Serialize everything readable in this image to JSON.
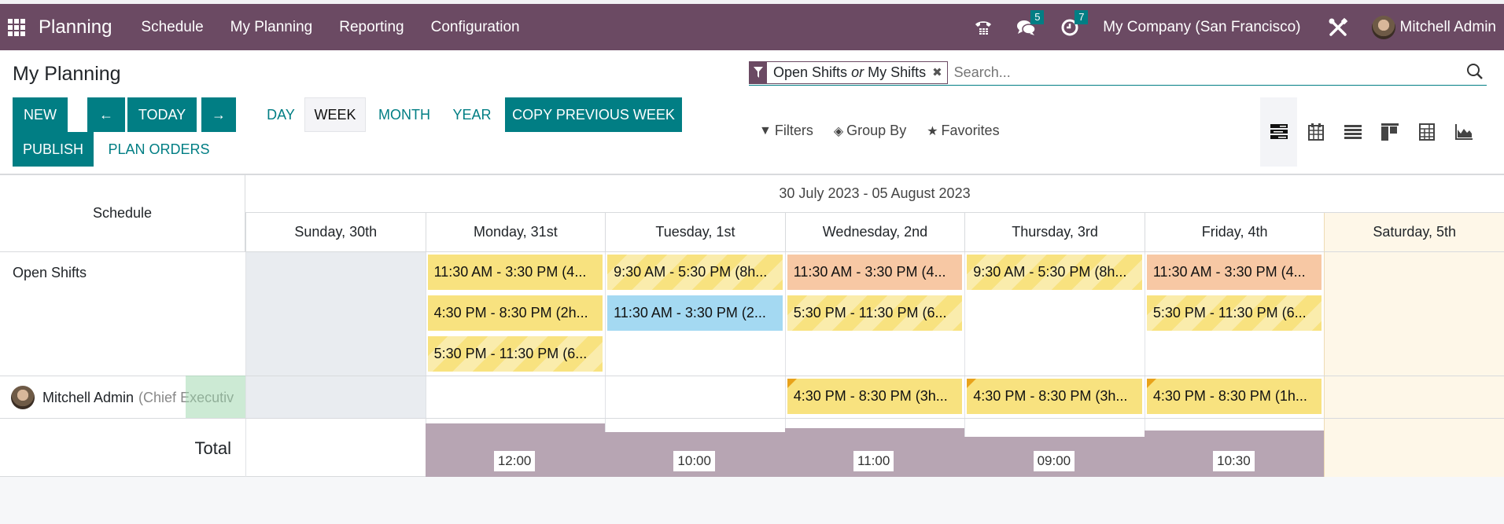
{
  "navbar": {
    "app_name": "Planning",
    "menus": [
      "Schedule",
      "My Planning",
      "Reporting",
      "Configuration"
    ],
    "messages_badge": "5",
    "activities_badge": "7",
    "company": "My Company (San Francisco)",
    "user": "Mitchell Admin",
    "icons": {
      "apps": "apps-grid-icon",
      "phone": "phone-icon",
      "messages": "chat-icon",
      "activities": "clock-icon",
      "debug": "tools-icon"
    }
  },
  "control": {
    "title": "My Planning",
    "buttons": {
      "new": "NEW",
      "prev": "←",
      "today": "TODAY",
      "next": "→",
      "day": "DAY",
      "week": "WEEK",
      "month": "MONTH",
      "year": "YEAR",
      "copy": "COPY PREVIOUS WEEK",
      "publish": "PUBLISH",
      "plan_orders": "PLAN ORDERS"
    },
    "active_scale": "WEEK",
    "search": {
      "facet_part1": "Open Shifts",
      "facet_or": "or",
      "facet_part2": "My Shifts",
      "placeholder": "Search..."
    },
    "filters": {
      "filters": "Filters",
      "group_by": "Group By",
      "favorites": "Favorites"
    },
    "views": [
      "gantt",
      "calendar",
      "list",
      "kanban",
      "pivot",
      "graph"
    ],
    "active_view": "gantt"
  },
  "gantt": {
    "schedule_header": "Schedule",
    "range": "30 July 2023 - 05 August 2023",
    "days": [
      "Sunday, 30th",
      "Monday, 31st",
      "Tuesday, 1st",
      "Wednesday, 2nd",
      "Thursday, 3rd",
      "Friday, 4th",
      "Saturday, 5th"
    ],
    "rows": [
      {
        "label": "Open Shifts"
      },
      {
        "label": "Mitchell Admin",
        "sublabel": "(Chief Executiv"
      }
    ],
    "pills": [
      {
        "row": 0,
        "day": 1,
        "slot": 0,
        "text": "11:30 AM - 3:30 PM (4...",
        "color": "yellow",
        "striped": false
      },
      {
        "row": 0,
        "day": 1,
        "slot": 1,
        "text": "4:30 PM - 8:30 PM (2h...",
        "color": "yellow",
        "striped": false
      },
      {
        "row": 0,
        "day": 1,
        "slot": 2,
        "text": "5:30 PM - 11:30 PM (6...",
        "color": "yellow",
        "striped": true
      },
      {
        "row": 0,
        "day": 2,
        "slot": 0,
        "text": "9:30 AM - 5:30 PM (8h...",
        "color": "yellow",
        "striped": true
      },
      {
        "row": 0,
        "day": 2,
        "slot": 1,
        "text": "11:30 AM - 3:30 PM (2...",
        "color": "blue",
        "striped": false
      },
      {
        "row": 0,
        "day": 3,
        "slot": 0,
        "text": "11:30 AM - 3:30 PM (4...",
        "color": "orange",
        "striped": false
      },
      {
        "row": 0,
        "day": 3,
        "slot": 1,
        "text": "5:30 PM - 11:30 PM (6...",
        "color": "yellow",
        "striped": true
      },
      {
        "row": 0,
        "day": 4,
        "slot": 0,
        "text": "9:30 AM - 5:30 PM (8h...",
        "color": "yellow",
        "striped": true
      },
      {
        "row": 0,
        "day": 5,
        "slot": 0,
        "text": "11:30 AM - 3:30 PM (4...",
        "color": "orange",
        "striped": false
      },
      {
        "row": 0,
        "day": 5,
        "slot": 1,
        "text": "5:30 PM - 11:30 PM (6...",
        "color": "yellow",
        "striped": true
      },
      {
        "row": 1,
        "day": 3,
        "slot": 0,
        "text": "4:30 PM - 8:30 PM (3h...",
        "color": "yellow",
        "striped": false,
        "corner": true
      },
      {
        "row": 1,
        "day": 4,
        "slot": 0,
        "text": "4:30 PM - 8:30 PM (3h...",
        "color": "yellow",
        "striped": false,
        "corner": true
      },
      {
        "row": 1,
        "day": 5,
        "slot": 0,
        "text": "4:30 PM - 8:30 PM (1h...",
        "color": "yellow",
        "striped": false,
        "corner": true
      }
    ],
    "total_label": "Total",
    "totals": [
      {
        "day": 1,
        "hours": 12,
        "label": "12:00"
      },
      {
        "day": 2,
        "hours": 10,
        "label": "10:00"
      },
      {
        "day": 3,
        "hours": 11,
        "label": "11:00"
      },
      {
        "day": 4,
        "hours": 9,
        "label": "09:00"
      },
      {
        "day": 5,
        "hours": 10.5,
        "label": "10:30"
      }
    ],
    "colors": {
      "yellow": "#f8e27f",
      "orange": "#f7c8a4",
      "blue": "#a4d9f2",
      "total_bar": "#b7a5b3",
      "brand": "#6b4a63",
      "primary": "#017e84"
    }
  }
}
